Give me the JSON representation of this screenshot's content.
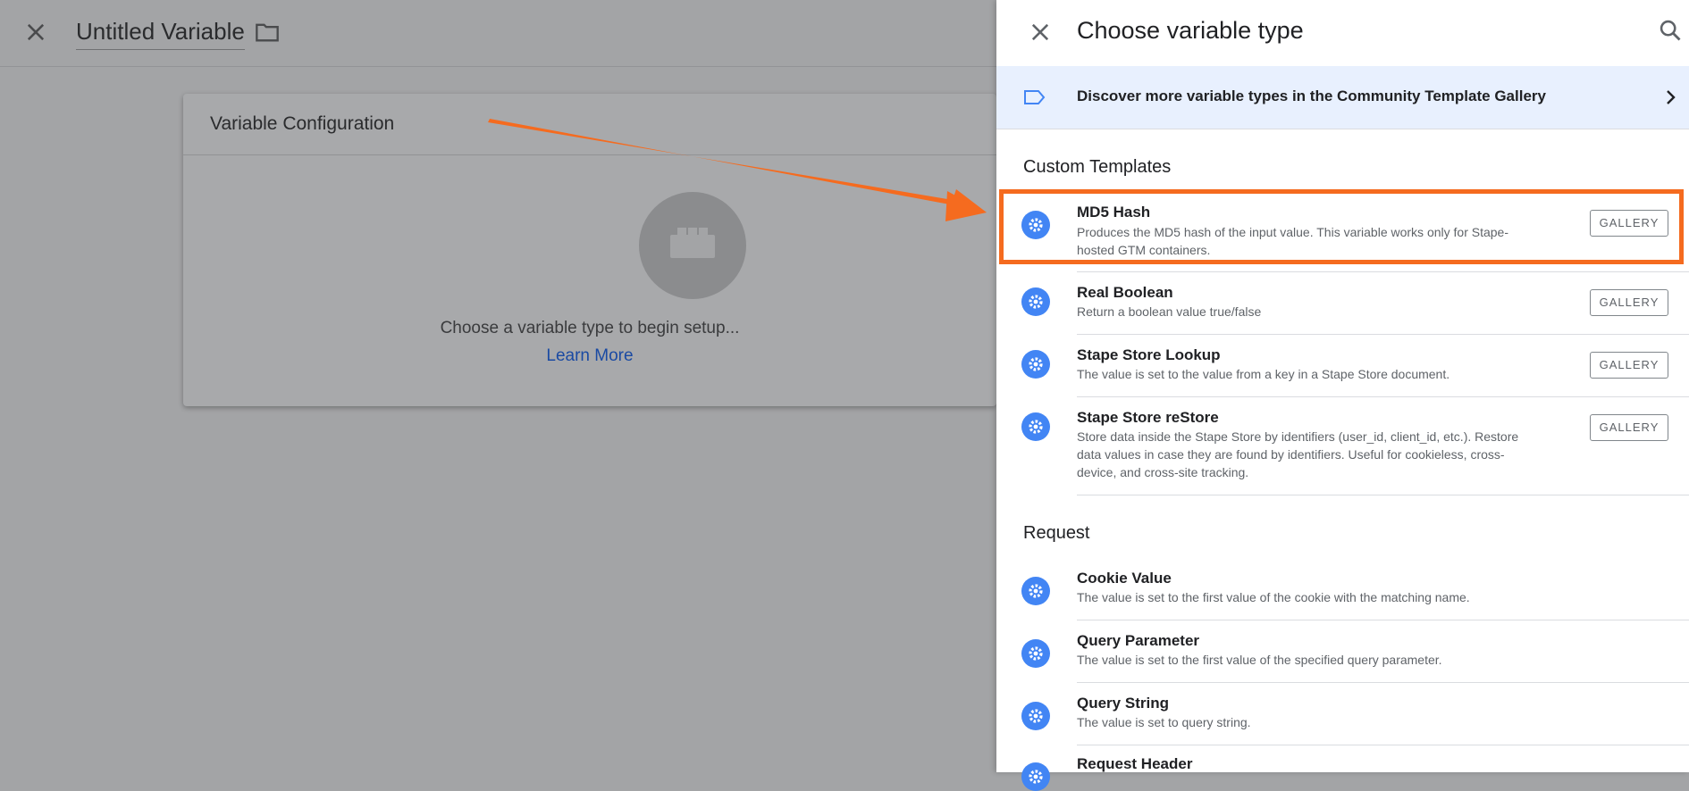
{
  "editor": {
    "title": "Untitled Variable",
    "card_title": "Variable Configuration",
    "empty_text": "Choose a variable type to begin setup...",
    "learn_more": "Learn More"
  },
  "panel": {
    "title": "Choose variable type",
    "discover_text": "Discover more variable types in the Community Template Gallery",
    "sections": [
      {
        "title": "Custom Templates",
        "items": [
          {
            "name": "MD5 Hash",
            "desc_line1": "Produces the MD5 hash of the input value. This variable works only for Stape-",
            "desc_line2": "hosted GTM containers.",
            "button": "GALLERY"
          },
          {
            "name": "Real Boolean",
            "desc_line1": "Return a boolean value true/false",
            "button": "GALLERY"
          },
          {
            "name": "Stape Store Lookup",
            "desc_line1": "The value is set to the value from a key in a Stape Store document.",
            "button": "GALLERY"
          },
          {
            "name": "Stape Store reStore",
            "desc_line1": "Store data inside the Stape Store by identifiers (user_id, client_id, etc.). Restore",
            "desc_line2": "data values in case they are found by identifiers. Useful for cookieless, cross-",
            "desc_line3": "device, and cross-site tracking.",
            "button": "GALLERY"
          }
        ]
      },
      {
        "title": "Request",
        "items": [
          {
            "name": "Cookie Value",
            "desc_line1": "The value is set to the first value of the cookie with the matching name."
          },
          {
            "name": "Query Parameter",
            "desc_line1": "The value is set to the first value of the specified query parameter."
          },
          {
            "name": "Query String",
            "desc_line1": "The value is set to query string."
          },
          {
            "name": "Request Header"
          }
        ]
      }
    ]
  },
  "colors": {
    "accent": "#4285f4",
    "highlight": "#f56b1f",
    "discover_bg": "#e8f0fe"
  },
  "icons": [
    "close-icon",
    "folder-icon",
    "search-icon",
    "tag-icon",
    "chevron-right-icon",
    "gear-icon",
    "brick-icon"
  ]
}
